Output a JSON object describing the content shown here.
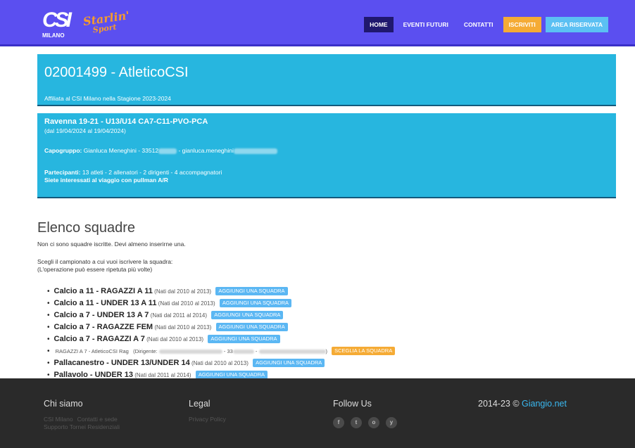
{
  "nav": {
    "logo_text": "CSI",
    "logo_sub": "MILANO",
    "star_logo_1": "Starlin'",
    "star_logo_2": "Sport",
    "items": [
      {
        "label": "HOME",
        "style": "active"
      },
      {
        "label": "EVENTI FUTURI",
        "style": ""
      },
      {
        "label": "CONTATTI",
        "style": ""
      },
      {
        "label": "ISCRIVITI",
        "style": "orange"
      },
      {
        "label": "AREA RISERVATA",
        "style": "cyan"
      }
    ]
  },
  "header": {
    "title": "02001499 - AtleticoCSI",
    "affiliation": "Affiliata al CSI Milano nella Stagione 2023-2024"
  },
  "trip": {
    "title": "Ravenna 19-21 - U13/U14 CA7-C11-PVO-PCA",
    "dates": "(dal 19/04/2024 al 19/04/2024)",
    "capo_label": "Capogruppo:",
    "capo_value": "Gianluca Meneghini - 33512",
    "capo_email": "- gianluca.meneghini",
    "partecipanti_label": "Partecipanti:",
    "partecipanti_value": "13 atleti - 2 allenatori - 2 dirigenti - 4 accompagnatori",
    "bus": "Siete interessati al viaggio con pullman A/R"
  },
  "squadre": {
    "title": "Elenco squadre",
    "none_text": "Non ci sono squadre iscritte. Devi almeno inserirne una.",
    "choose_1": "Scegli il campionato a cui vuoi iscrivere la squadra:",
    "choose_2": "(L'operazione può essere ripetuta più volte)",
    "items": [
      {
        "name": "Calcio a 11 - RAGAZZI A 11",
        "years": "(Nati dal 2010 al 2013)",
        "action": "AGGIUNGI UNA SQUADRA"
      },
      {
        "name": "Calcio a 11 - UNDER 13 A 11",
        "years": "(Nati dal 2010 al 2013)",
        "action": "AGGIUNGI UNA SQUADRA"
      },
      {
        "name": "Calcio a 7 - UNDER 13 A 7",
        "years": "(Nati dal 2011 al 2014)",
        "action": "AGGIUNGI UNA SQUADRA"
      },
      {
        "name": "Calcio a 7 - RAGAZZE FEM",
        "years": "(Nati dal 2010 al 2013)",
        "action": "AGGIUNGI UNA SQUADRA"
      },
      {
        "name": "Calcio a 7 - RAGAZZI A 7",
        "years": "(Nati dal 2010 al 2013)",
        "action": "AGGIUNGI UNA SQUADRA"
      }
    ],
    "sub_item": {
      "text": "RAGAZZI A 7 - AtleticoCSI Rag",
      "dirigente": "(Dirigente:",
      "phone": "- 33",
      "close": ")",
      "action": "SCEGLIA LA SQUADRA"
    },
    "items2": [
      {
        "name": "Pallacanestro - UNDER 13/UNDER 14",
        "years": "(Nati dal 2010 al 2013)",
        "action": "AGGIUNGI UNA SQUADRA"
      },
      {
        "name": "Pallavolo - UNDER 13",
        "years": "(Nati dal 2011 al 2014)",
        "action": "AGGIUNGI UNA SQUADRA"
      }
    ]
  },
  "footer": {
    "chi_title": "Chi siamo",
    "chi_links": [
      "CSI Milano",
      "Contatti e sede"
    ],
    "chi_link3": "Supporto Tornei Residenziali",
    "legal_title": "Legal",
    "legal_link": "Privacy Policy",
    "follow_title": "Follow Us",
    "social": [
      "f",
      "t",
      "o",
      "y"
    ],
    "social_icons": [
      "facebook-icon",
      "twitter-icon",
      "instagram-icon",
      "youtube-icon"
    ],
    "copy_prefix": "2014-23 © ",
    "copy_link": "Giangio.net"
  }
}
